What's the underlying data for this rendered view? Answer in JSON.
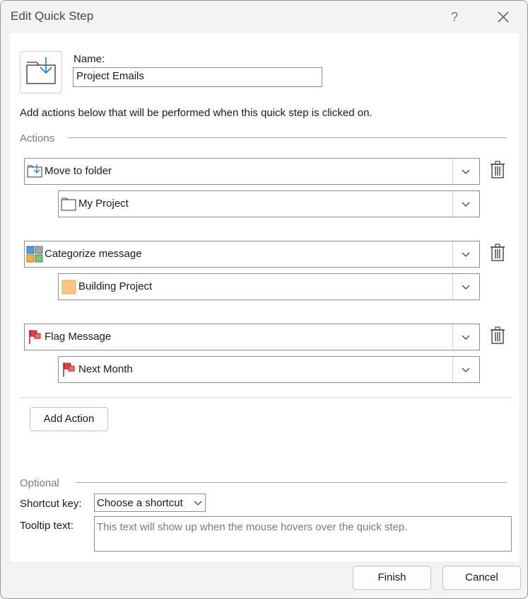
{
  "window": {
    "title": "Edit Quick Step",
    "help_glyph": "?"
  },
  "name_field": {
    "label": "Name:",
    "value": "Project Emails"
  },
  "description": "Add actions below that will be performed when this quick step is clicked on.",
  "actions_section": {
    "label": "Actions",
    "items": [
      {
        "action": "Move to folder",
        "action_icon": "move-to-folder-icon",
        "option": "My Project",
        "option_icon": "folder-icon"
      },
      {
        "action": "Categorize message",
        "action_icon": "categorize-icon",
        "option": "Building Project",
        "option_icon": "category-color-icon",
        "category_color": "#fcc585"
      },
      {
        "action": "Flag Message",
        "action_icon": "flag-icon",
        "option": "Next Month",
        "option_icon": "flag-icon",
        "flag_color": "#e04646"
      }
    ],
    "add_action_label": "Add Action"
  },
  "optional_section": {
    "label": "Optional",
    "shortcut_label": "Shortcut key:",
    "shortcut_value": "Choose a shortcut",
    "tooltip_label": "Tooltip text:",
    "tooltip_placeholder": "This text will show up when the mouse hovers over the quick step."
  },
  "footer": {
    "finish_label": "Finish",
    "cancel_label": "Cancel"
  },
  "colors": {
    "accent_blue": "#1f7ac9",
    "dialog_bg": "#f3f3f3",
    "panel_bg": "#ffffff"
  }
}
